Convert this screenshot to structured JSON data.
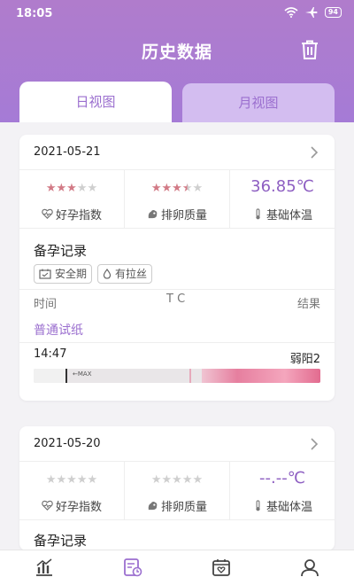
{
  "status": {
    "time": "18:05",
    "battery": "94"
  },
  "header": {
    "title": "历史数据"
  },
  "tabs": [
    {
      "label": "日视图"
    },
    {
      "label": "月视图"
    }
  ],
  "records": [
    {
      "date": "2021-05-21",
      "fertility": {
        "label": "好孕指数",
        "stars_on": 3
      },
      "ovulation": {
        "label": "排卵质量",
        "stars_on": 3.5
      },
      "temperature": {
        "value": "36.85℃",
        "label": "基础体温"
      },
      "prep": {
        "title": "备孕记录",
        "tags": [
          {
            "label": "安全期"
          },
          {
            "label": "有拉丝"
          }
        ]
      },
      "test": {
        "col_time": "时间",
        "col_tc": "T C",
        "col_result": "结果",
        "type": "普通试纸",
        "time": "14:47",
        "result": "弱阳2",
        "strip_text": "←MAX"
      }
    },
    {
      "date": "2021-05-20",
      "fertility": {
        "label": "好孕指数",
        "stars_on": 0
      },
      "ovulation": {
        "label": "排卵质量",
        "stars_on": 0
      },
      "temperature": {
        "value": "--.--℃",
        "label": "基础体温"
      },
      "prep": {
        "title": "备孕记录"
      }
    }
  ],
  "colors": {
    "accent": "#9b6fcf",
    "star_on": "#d27a86",
    "star_off": "#cfcfcf"
  }
}
